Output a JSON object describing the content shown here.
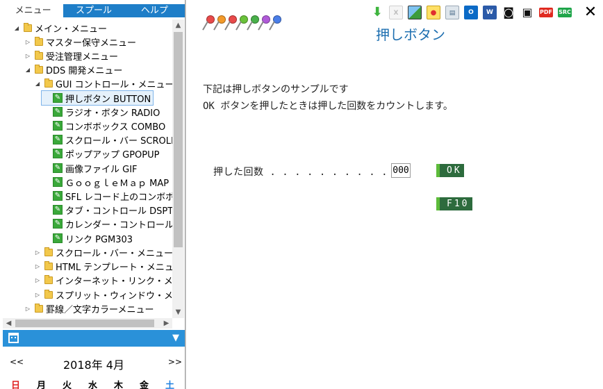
{
  "tabs": [
    {
      "label": "メニュー",
      "active": true
    },
    {
      "label": "スプール",
      "active": false
    },
    {
      "label": "ヘルプ",
      "active": false
    }
  ],
  "tree": {
    "n0": {
      "label": "メイン・メニュー"
    },
    "n1": {
      "label": "マスター保守メニュー"
    },
    "n2": {
      "label": "受注管理メニュー"
    },
    "n3": {
      "label": "DDS 開発メニュー"
    },
    "n4": {
      "label": "GUI コントロール・メニュー"
    },
    "n5": {
      "label": "押しボタン BUTTON"
    },
    "n6": {
      "label": "ラジオ・ボタン RADIO"
    },
    "n7": {
      "label": "コンボボックス COMBO"
    },
    "n8": {
      "label": "スクロール・バー SCROLL"
    },
    "n9": {
      "label": "ポップアップ GPOPUP"
    },
    "n10": {
      "label": "画像ファイル GIF"
    },
    "n11": {
      "label": "ＧｏｏｇｌｅＭａｐ MAP"
    },
    "n12": {
      "label": "SFL レコード上のコンボボックス"
    },
    "n13": {
      "label": "タブ・コントロール DSPTAB"
    },
    "n14": {
      "label": "カレンダー・コントロール"
    },
    "n15": {
      "label": "リンク PGM303"
    },
    "n16": {
      "label": "スクロール・バー・メニュー"
    },
    "n17": {
      "label": "HTML テンプレート・メニュー"
    },
    "n18": {
      "label": "インターネット・リンク・メニュー"
    },
    "n19": {
      "label": "スプリット・ウィンドウ・メニュー"
    },
    "n20": {
      "label": "罫線／文字カラーメニュー"
    }
  },
  "calendar": {
    "prev": "<<",
    "next": ">>",
    "title": "2018年 4月",
    "days": [
      "日",
      "月",
      "火",
      "水",
      "木",
      "金",
      "土"
    ]
  },
  "page": {
    "title": "押しボタン",
    "desc_line1": "下記は押しボタンのサンプルです",
    "desc_line2": "OK ボタンを押したときは押した回数をカウントします。",
    "count_label": "押した回数 . . . . . . . . . .",
    "count_value": "000",
    "ok_label": "OK",
    "f10_label": "F10"
  },
  "toolbar": {
    "excel": "X",
    "outlook": "O",
    "word": "W",
    "pdf": "PDF",
    "src": "SRC"
  },
  "icons": {
    "pins": [
      "#e84a4a",
      "#f39a2a",
      "#e84a4a",
      "#6ac23a",
      "#49b04a",
      "#b05ad8",
      "#4a7ee8"
    ],
    "download": "download-icon",
    "close": "close-icon"
  },
  "colors": {
    "tab_bar": "#1e7ec8",
    "calendar_bar": "#2a91d9",
    "title_blue": "#1e6fb0",
    "button_green": "#2d6b3d",
    "button_accent": "#5dbb3a"
  }
}
